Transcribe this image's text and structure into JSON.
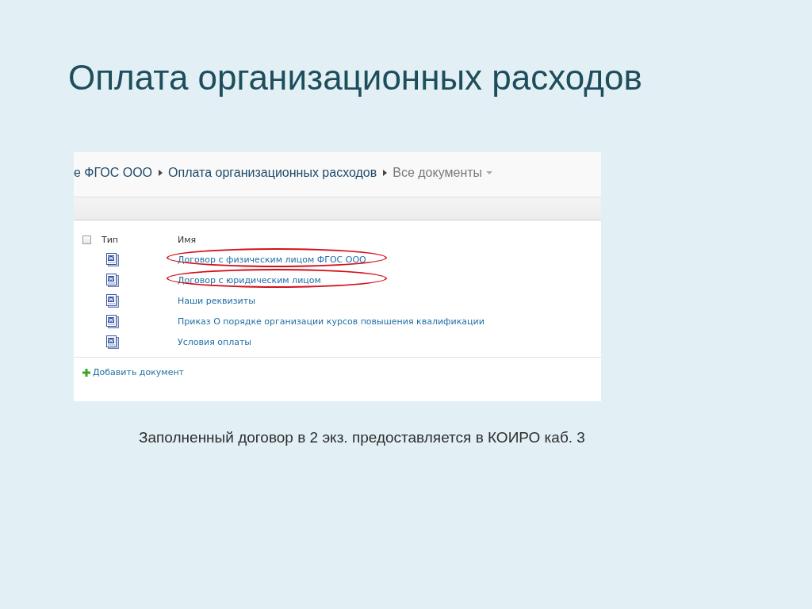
{
  "slide_title": "Оплата организационных расходов",
  "screenshot": {
    "breadcrumb": [
      "е ФГОС ООО",
      "Оплата организационных расходов",
      "Все документы"
    ],
    "select_all": {
      "checked": false
    },
    "columns": [
      "Тип",
      "Имя"
    ],
    "documents": [
      {
        "name": "Договор с физическим лицом ФГОС ООО",
        "circled": true
      },
      {
        "name": "Договор с юридическим лицом",
        "circled": true
      },
      {
        "name": "Наши реквизиты",
        "circled": false
      },
      {
        "name": "Приказ О порядке организации курсов повышения квалификации",
        "circled": false
      },
      {
        "name": "Условия оплаты",
        "circled": false
      }
    ],
    "add_link": "Добавить документ"
  },
  "caption": "Заполненный договор в 2 экз. предоставляется в КОИРО каб. 3"
}
